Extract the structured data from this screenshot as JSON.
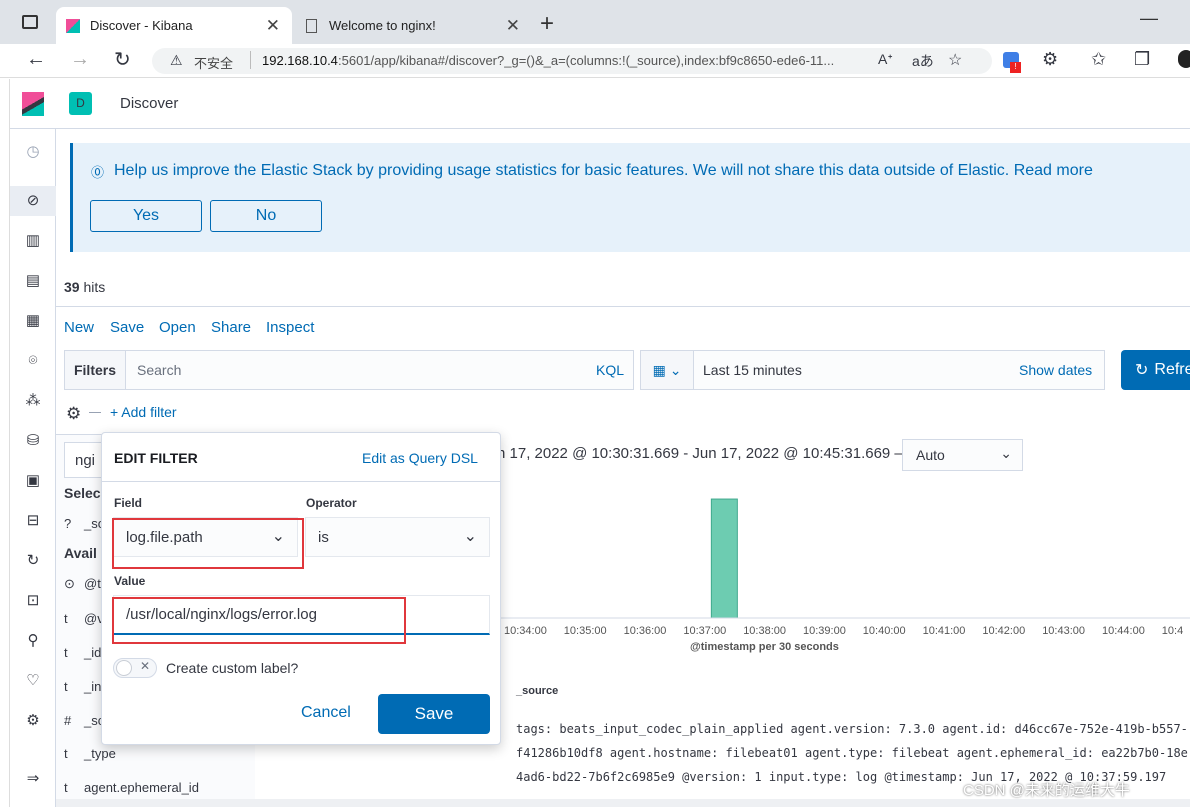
{
  "browser": {
    "tabs": [
      {
        "title": "Discover - Kibana"
      },
      {
        "title": "Welcome to nginx!"
      }
    ],
    "security_label": "不安全",
    "url_host": "192.168.10.4",
    "url_rest": ":5601/app/kibana#/discover?_g=()&_a=(columns:!(_source),index:bf9c8650-ede6-11..."
  },
  "header": {
    "space_badge": "D",
    "title": "Discover"
  },
  "callout": {
    "text": "Help us improve the Elastic Stack by providing usage statistics for basic features. We will not share this data outside of Elastic.",
    "read_more": "Read more",
    "yes": "Yes",
    "no": "No"
  },
  "hits": {
    "count": "39",
    "label": "hits"
  },
  "toolbar": {
    "new": "New",
    "save": "Save",
    "open": "Open",
    "share": "Share",
    "inspect": "Inspect"
  },
  "query": {
    "filters_label": "Filters",
    "placeholder": "Search",
    "language": "KQL",
    "time_range": "Last 15 minutes",
    "show_dates": "Show dates",
    "refresh": "Refresh"
  },
  "add_filter": "+ Add filter",
  "histogram": {
    "range": "n 17, 2022 @ 10:30:31.669 - Jun 17, 2022 @ 10:45:31.669 —",
    "interval": "Auto",
    "xlabel": "@timestamp per 30 seconds",
    "ticks": [
      "10:34:00",
      "10:35:00",
      "10:36:00",
      "10:37:00",
      "10:38:00",
      "10:39:00",
      "10:40:00",
      "10:41:00",
      "10:42:00",
      "10:43:00",
      "10:44:00",
      "10:4"
    ]
  },
  "chart_data": {
    "type": "bar",
    "x": [
      "10:37:30"
    ],
    "values": [
      39
    ],
    "xlabel": "@timestamp per 30 seconds"
  },
  "sidebar": {
    "index_partial": "ngi",
    "selected_label": "Selec",
    "selected_field": "_so",
    "available_label": "Avail",
    "fields": [
      {
        "type": "⊙",
        "name": "@t"
      },
      {
        "type": "t",
        "name": "@v"
      },
      {
        "type": "t",
        "name": "_id"
      },
      {
        "type": "t",
        "name": "_in"
      },
      {
        "type": "#",
        "name": "_sc"
      },
      {
        "type": "t",
        "name": "_type"
      },
      {
        "type": "t",
        "name": "agent.ephemeral_id"
      }
    ]
  },
  "filter_popover": {
    "title": "EDIT FILTER",
    "edit_dsl": "Edit as Query DSL",
    "field_label": "Field",
    "field_value": "log.file.path",
    "operator_label": "Operator",
    "operator_value": "is",
    "value_label": "Value",
    "value": "/usr/local/nginx/logs/error.log",
    "custom_label": "Create custom label?",
    "cancel": "Cancel",
    "save": "Save"
  },
  "results": {
    "column": "_source",
    "row1": "tags: beats_input_codec_plain_applied agent.version: 7.3.0 agent.id: d46cc67e-752e-419b-b557-",
    "row2": "f41286b10df8 agent.hostname: filebeat01 agent.type: filebeat agent.ephemeral_id: ea22b7b0-18e",
    "row3": "4ad6-bd22-7b6f2c6985e9 @version: 1 input.type: log @timestamp: Jun 17, 2022 @ 10:37:59.197"
  },
  "watermark": "CSDN @未来的运维大牛"
}
